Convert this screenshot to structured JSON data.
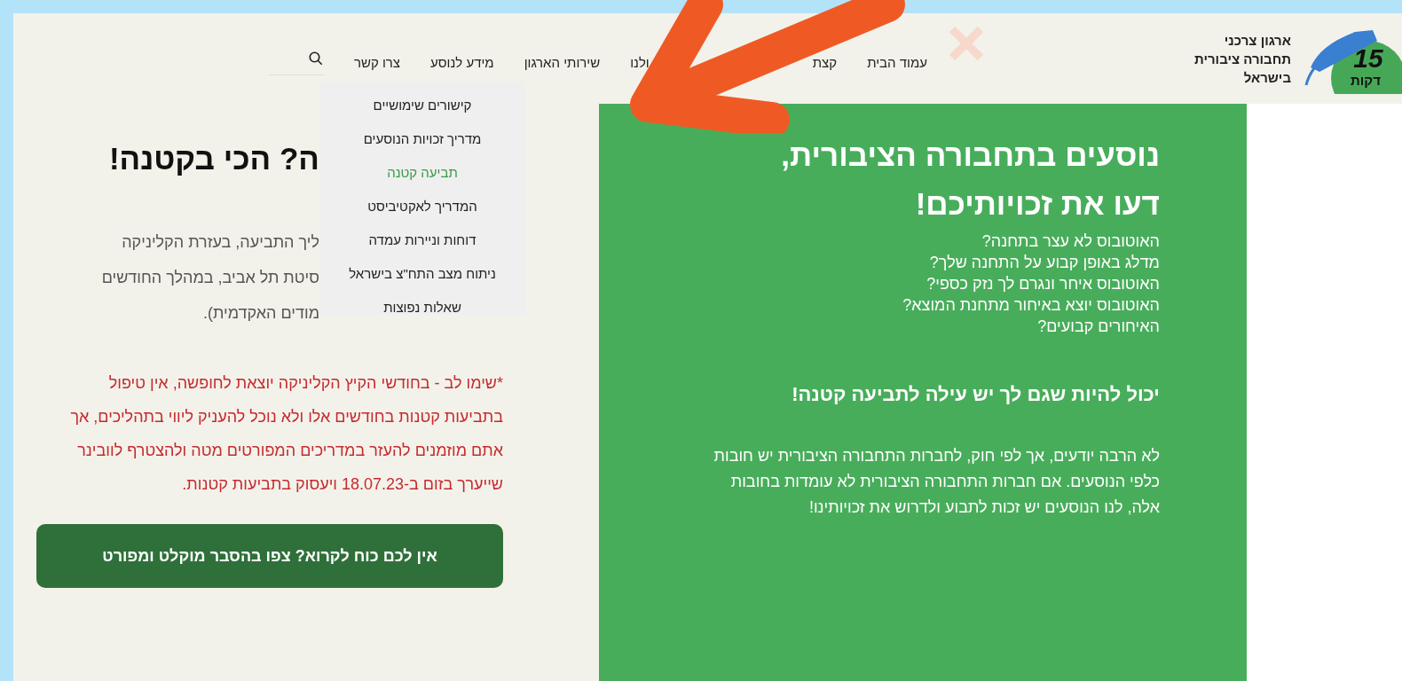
{
  "header": {
    "org_name": [
      "ארגון צרכני",
      "תחבורה ציבורית",
      "בישראל"
    ],
    "logo": {
      "number": "15",
      "caption": "דקות"
    },
    "nav": [
      {
        "label": "עמוד הבית"
      },
      {
        "label": "קצת"
      },
      {
        "label": "ולנו"
      },
      {
        "label": "שירותי הארגון"
      },
      {
        "label": "מידע לנוסע"
      },
      {
        "label": "צרו קשר"
      }
    ],
    "dropdown": [
      {
        "label": "קישורים שימושיים",
        "selected": false
      },
      {
        "label": "מדריך זכויות הנוסעים",
        "selected": false
      },
      {
        "label": "תביעה קטנה",
        "selected": true
      },
      {
        "label": "המדריך לאקטיביסט",
        "selected": false
      },
      {
        "label": "דוחות וניירות עמדה",
        "selected": false
      },
      {
        "label": "ניתוח מצב התח\"צ בישראל",
        "selected": false
      },
      {
        "label": "שאלות נפוצות",
        "selected": false
      }
    ]
  },
  "left": {
    "heading": "ה? הכי בקטנה!",
    "intro_lines": [
      "ליך התביעה, בעזרת הקליניקה",
      "סיטת תל אביב, במהלך החודשים",
      "מודים האקדמית)."
    ],
    "notice": "*שימו לב - בחודשי הקיץ הקליניקה יוצאת לחופשה, אין טיפול בתביעות קטנות בחודשים אלו ולא נוכל להעניק ליווי בתהליכים, אך אתם מוזמנים להעזר במדריכים המפורטים מטה ולהצטרף לוובינר שייערך בזום ב-18.07.23 ויעסוק בתביעות קטנות.",
    "button": "אין לכם כוח לקרוא? צפו בהסבר מוקלט ומפורט"
  },
  "panel": {
    "heading_lines": [
      "נוסעים בתחבורה הציבורית,",
      "דעו את זכויותיכם!"
    ],
    "questions": [
      "האוטובוס לא עצר בתחנה?",
      "מדלג באופן קבוע על התחנה שלך?",
      "האוטובוס איחר ונגרם לך נזק כספי?",
      "האוטובוס יוצא באיחור מתחנת המוצא?",
      "האיחורים קבועים?"
    ],
    "subheading": "יכול להיות שגם לך יש עילה לתביעה קטנה!",
    "paragraph": "לא הרבה יודעים, אך לפי חוק, לחברות התחבורה הציבורית יש חובות כלפי הנוסעים. אם חברות התחבורה הציבורית לא עומדות בחובות אלה, לנו הנוסעים יש זכות לתבוע ולדרוש את זכויותינו!"
  }
}
